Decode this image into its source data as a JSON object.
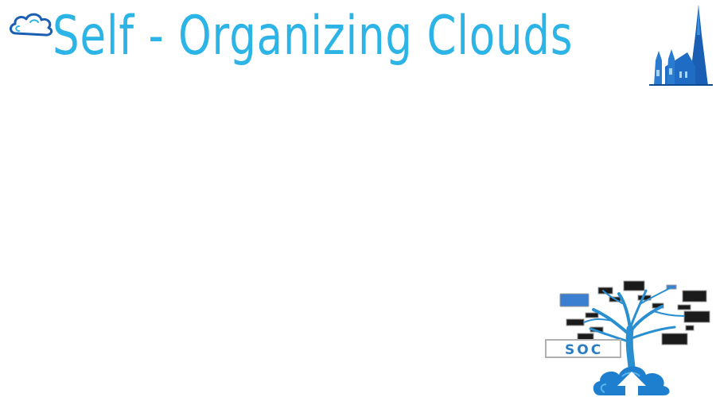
{
  "slide": {
    "title": "Self - Organizing Clouds",
    "soc_label": "SOC"
  },
  "icons": {
    "top_left": "cloud-logo-icon",
    "top_right": "cathedral-icon",
    "bottom_right": "tree-network-soc-illustration"
  },
  "colors": {
    "title": "#2cb4e6",
    "accent_dark_blue": "#1a5fb4",
    "tree_blue": "#2a8fd0",
    "soc_label": "#2a7cc4"
  }
}
